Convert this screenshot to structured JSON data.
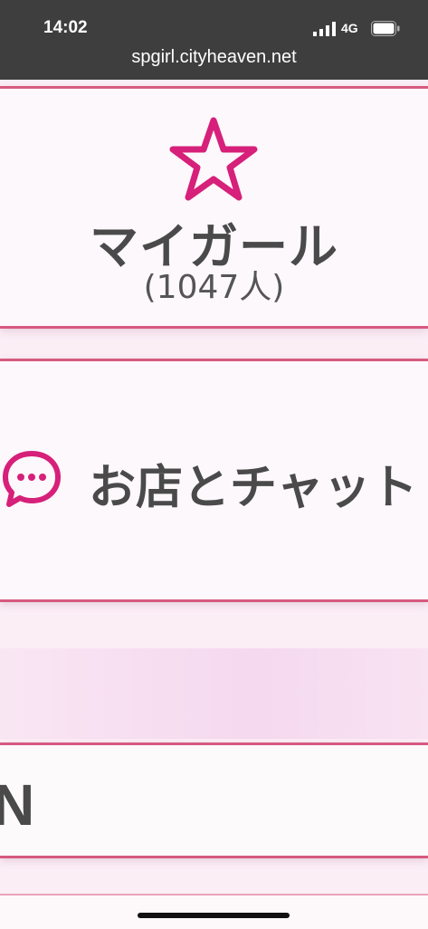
{
  "status_bar": {
    "time": "14:02",
    "network": "4G",
    "url": "spgirl.cityheaven.net"
  },
  "my_girl": {
    "label": "マイガール",
    "count": "(1047人)",
    "icon": "star-outline-icon",
    "accent_color": "#d6207a"
  },
  "chat": {
    "label": "お店とチャット",
    "icon": "chat-bubble-icon"
  },
  "partial_item": {
    "label": "N"
  },
  "colors": {
    "border": "#d65a80",
    "text": "#4a4a4a",
    "status_bg": "#3e3e3e"
  }
}
